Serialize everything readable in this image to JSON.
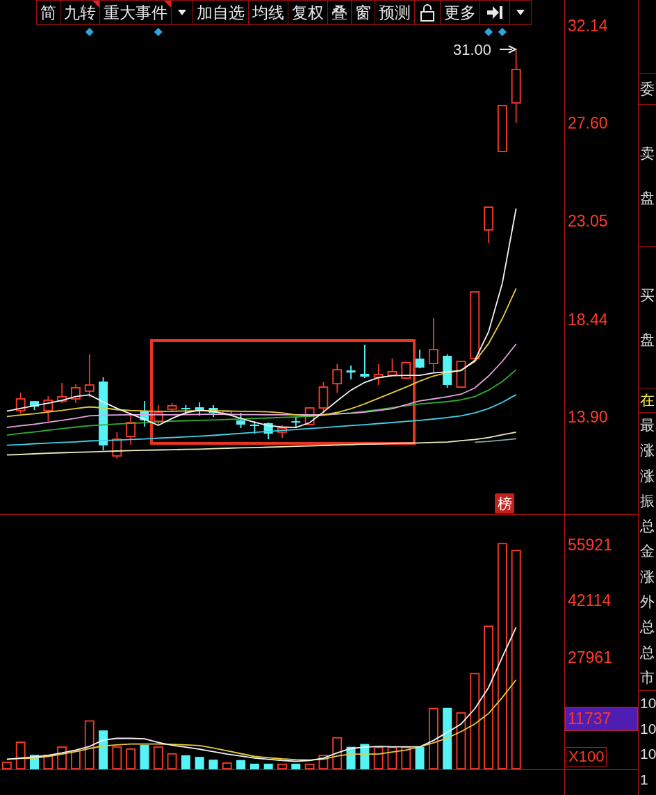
{
  "toolbar": [
    {
      "kind": "button",
      "label": "简",
      "flag": false
    },
    {
      "kind": "button",
      "label": "九转",
      "flag": true
    },
    {
      "kind": "button",
      "label": "重大事件",
      "flag": true
    },
    {
      "kind": "dropdown",
      "flag": false
    },
    {
      "kind": "button",
      "label": "加自选",
      "flag": false
    },
    {
      "kind": "button",
      "label": "均线",
      "flag": false
    },
    {
      "kind": "button",
      "label": "复权",
      "flag": false
    },
    {
      "kind": "button",
      "label": "叠",
      "flag": false
    },
    {
      "kind": "button",
      "label": "窗",
      "flag": false
    },
    {
      "kind": "button",
      "label": "预测",
      "flag": false
    },
    {
      "kind": "lock",
      "flag": false
    },
    {
      "kind": "button",
      "label": "更多",
      "flag": false
    },
    {
      "kind": "arrow_to_bar",
      "flag": false
    },
    {
      "kind": "dropdown",
      "flag": false
    }
  ],
  "price_chart": {
    "high_label": "31.00",
    "badge": "榜",
    "chart_data": {
      "type": "candlestick",
      "ylim": [
        9.33,
        33.34
      ],
      "yticks": [
        {
          "value": 32.14,
          "label": "32.14"
        },
        {
          "value": 27.6,
          "label": "27.60"
        },
        {
          "value": 23.05,
          "label": "23.05"
        },
        {
          "value": 18.44,
          "label": "18.44"
        },
        {
          "value": 13.9,
          "label": "13.90"
        }
      ],
      "ohlc": [
        null,
        [
          14.19,
          15.03,
          14.06,
          14.74
        ],
        [
          14.64,
          14.64,
          14.22,
          14.38
        ],
        [
          14.19,
          14.87,
          13.7,
          14.68
        ],
        [
          14.64,
          15.49,
          14.55,
          14.84
        ],
        [
          14.74,
          15.42,
          14.55,
          15.26
        ],
        [
          15.1,
          16.82,
          14.81,
          15.39
        ],
        [
          15.55,
          15.75,
          12.34,
          12.57
        ],
        [
          12.08,
          13.19,
          11.95,
          12.86
        ],
        [
          12.99,
          13.96,
          12.6,
          13.64
        ],
        [
          14.16,
          14.64,
          13.45,
          13.74
        ],
        [
          13.7,
          14.45,
          13.51,
          14.09
        ],
        [
          14.26,
          14.55,
          14.16,
          14.42
        ],
        [
          14.32,
          14.45,
          14.02,
          14.26
        ],
        [
          14.35,
          14.58,
          13.96,
          14.22
        ],
        [
          14.32,
          14.45,
          13.9,
          14.09
        ],
        [
          14.03,
          14.22,
          13.96,
          14.16
        ],
        [
          13.74,
          14.09,
          13.38,
          13.54
        ],
        [
          13.54,
          13.7,
          13.12,
          13.48
        ],
        [
          13.61,
          13.64,
          12.86,
          13.12
        ],
        [
          13.19,
          13.51,
          12.93,
          13.38
        ],
        [
          13.7,
          13.87,
          13.38,
          13.64
        ],
        [
          13.54,
          14.35,
          13.51,
          14.32
        ],
        [
          14.32,
          15.52,
          14.06,
          15.29
        ],
        [
          15.45,
          16.36,
          15.03,
          16.1
        ],
        [
          16.07,
          16.3,
          15.65,
          15.97
        ],
        [
          15.91,
          17.27,
          15.71,
          15.78
        ],
        [
          15.75,
          16.36,
          15.39,
          15.88
        ],
        [
          15.84,
          16.62,
          15.84,
          16.01
        ],
        [
          15.71,
          16.49,
          15.65,
          16.43
        ],
        [
          16.62,
          17.04,
          16.17,
          16.2
        ],
        [
          16.39,
          18.5,
          15.97,
          17.04
        ],
        [
          16.75,
          16.82,
          15.26,
          15.39
        ],
        [
          15.29,
          16.49,
          15.29,
          16.49
        ],
        [
          16.62,
          19.73,
          16.62,
          19.73
        ],
        [
          22.62,
          23.68,
          22.0,
          23.68
        ],
        [
          26.28,
          28.42,
          26.28,
          28.42
        ],
        [
          28.54,
          31.0,
          27.6,
          30.1
        ],
        null,
        null,
        null
      ],
      "series": [
        {
          "type": "line",
          "color": "#f4f4f4",
          "values": [
            14.17,
            14.3,
            14.42,
            14.54,
            14.67,
            14.85,
            14.93,
            14.6,
            14.3,
            14.04,
            13.78,
            13.51,
            13.83,
            14.1,
            14.21,
            14.15,
            14.03,
            13.83,
            13.65,
            13.5,
            13.43,
            13.41,
            13.63,
            14.13,
            14.65,
            15.15,
            15.51,
            15.73,
            15.82,
            15.84,
            15.84,
            15.95,
            16.0,
            16.06,
            16.54,
            17.87,
            20.14,
            23.62,
            null,
            null,
            null
          ]
        },
        {
          "type": "line",
          "color": "#e6cc3c",
          "values": [
            13.92,
            13.99,
            14.05,
            14.13,
            14.2,
            14.29,
            14.37,
            14.32,
            14.24,
            14.2,
            14.18,
            14.16,
            14.16,
            14.18,
            14.19,
            14.19,
            14.18,
            14.16,
            14.15,
            14.14,
            14.09,
            13.99,
            13.95,
            13.99,
            14.11,
            14.28,
            14.51,
            14.77,
            15.03,
            15.29,
            15.57,
            15.81,
            15.96,
            16.08,
            16.48,
            17.32,
            18.49,
            19.89,
            null,
            null,
            null
          ]
        },
        {
          "type": "line",
          "color": "#e3a2dc",
          "values": [
            13.41,
            13.49,
            13.56,
            13.65,
            13.74,
            13.84,
            13.95,
            13.98,
            13.99,
            14.0,
            14.0,
            14.0,
            14.0,
            14.01,
            14.02,
            14.03,
            14.02,
            14.01,
            14.01,
            14.0,
            14.0,
            14.0,
            14.0,
            14.01,
            14.04,
            14.07,
            14.12,
            14.2,
            14.28,
            14.47,
            14.65,
            14.74,
            14.84,
            14.96,
            15.25,
            15.81,
            16.49,
            17.3,
            null,
            null,
            null
          ]
        },
        {
          "type": "line",
          "color": "#2fae35",
          "values": [
            13.05,
            13.13,
            13.2,
            13.28,
            13.35,
            13.43,
            13.49,
            13.53,
            13.57,
            13.6,
            13.63,
            13.67,
            13.7,
            13.72,
            13.74,
            13.76,
            13.78,
            13.8,
            13.83,
            13.85,
            13.88,
            13.9,
            13.93,
            13.98,
            14.04,
            14.09,
            14.16,
            14.24,
            14.33,
            14.42,
            14.5,
            14.56,
            14.61,
            14.7,
            14.85,
            15.15,
            15.55,
            16.1,
            null,
            null,
            null
          ]
        },
        {
          "type": "line",
          "color": "#3fd3ea",
          "values": [
            12.58,
            12.61,
            12.65,
            12.68,
            12.71,
            12.74,
            12.78,
            12.8,
            12.82,
            12.85,
            12.87,
            12.91,
            12.94,
            12.97,
            13.0,
            13.04,
            13.09,
            13.13,
            13.18,
            13.22,
            13.27,
            13.31,
            13.36,
            13.4,
            13.45,
            13.5,
            13.54,
            13.59,
            13.64,
            13.69,
            13.74,
            13.8,
            13.87,
            13.95,
            14.09,
            14.29,
            14.58,
            14.94,
            null,
            null,
            null
          ]
        },
        {
          "type": "line",
          "color": "#ecebb8",
          "values": [
            12.13,
            12.15,
            12.18,
            12.21,
            12.23,
            12.25,
            12.27,
            12.29,
            12.31,
            12.33,
            12.35,
            12.36,
            12.37,
            12.39,
            12.4,
            12.42,
            12.44,
            12.46,
            12.47,
            12.49,
            12.51,
            12.53,
            12.55,
            12.57,
            12.59,
            12.61,
            12.63,
            12.64,
            12.66,
            12.68,
            12.69,
            12.71,
            12.73,
            12.79,
            12.85,
            12.94,
            13.07,
            13.19,
            null,
            null,
            null
          ]
        },
        {
          "type": "line",
          "color": "#7fa9a8",
          "values": [
            null,
            null,
            null,
            null,
            null,
            null,
            null,
            null,
            null,
            null,
            null,
            null,
            null,
            null,
            null,
            null,
            null,
            null,
            null,
            null,
            null,
            null,
            null,
            null,
            null,
            null,
            null,
            null,
            null,
            null,
            null,
            null,
            null,
            null,
            12.72,
            12.76,
            12.82,
            12.88,
            null,
            null,
            null
          ]
        }
      ]
    }
  },
  "volume_chart": {
    "current_value": "11737",
    "unit": "X100",
    "chart_data": {
      "type": "bar",
      "stacked": true,
      "ylim": [
        0,
        63390
      ],
      "yticks": [
        {
          "value": 55921,
          "label": "55921"
        },
        {
          "value": 42114,
          "label": "42114"
        },
        {
          "value": 27961,
          "label": "27961"
        }
      ],
      "series": [
        {
          "color": "#ff3c28",
          "values": [
            1900,
            6900,
            null,
            3600,
            5700,
            4700,
            12200,
            null,
            5700,
            5200,
            null,
            5700,
            4000,
            null,
            null,
            null,
            1700,
            null,
            null,
            null,
            1400,
            null,
            1400,
            3600,
            8000,
            null,
            null,
            5600,
            5600,
            5600,
            null,
            15300,
            null,
            14200,
            24000,
            35800,
            56400,
            54700,
            null,
            null,
            null
          ]
        },
        {
          "color": "#55f2f6",
          "values": [
            null,
            null,
            3600,
            null,
            null,
            null,
            null,
            9700,
            null,
            null,
            6100,
            null,
            null,
            3500,
            3100,
            2400,
            null,
            2300,
            1400,
            1400,
            null,
            1400,
            null,
            null,
            null,
            5600,
            6300,
            null,
            null,
            null,
            5600,
            null,
            15300,
            null,
            null,
            null,
            null,
            null,
            null,
            null,
            null
          ]
        },
        {
          "type": "line",
          "color": "#f4f4f4",
          "values": [
            2500,
            2800,
            3100,
            3500,
            4100,
            4800,
            5700,
            7300,
            7700,
            7700,
            7600,
            6700,
            6000,
            5500,
            5000,
            4400,
            3800,
            3300,
            2800,
            2500,
            2200,
            2000,
            2200,
            2800,
            4100,
            5200,
            5500,
            5700,
            5600,
            5600,
            5600,
            7200,
            9200,
            11300,
            15100,
            20400,
            28000,
            35400,
            null,
            null,
            null
          ]
        },
        {
          "type": "line",
          "color": "#e6cc3c",
          "values": [
            2500,
            2700,
            2800,
            3200,
            3800,
            4400,
            5200,
            5800,
            6100,
            6300,
            6300,
            6300,
            6200,
            6100,
            5900,
            5300,
            4600,
            3900,
            3200,
            2900,
            2600,
            2400,
            2300,
            2500,
            3300,
            3800,
            3800,
            3800,
            4300,
            4800,
            5600,
            6600,
            7800,
            9400,
            11300,
            13900,
            17900,
            22300,
            null,
            null,
            null
          ]
        }
      ]
    }
  },
  "side_panel": {
    "header": "委",
    "vertical_labels": [
      "卖盘",
      "买盘"
    ],
    "highlight": "在",
    "labels": [
      "最",
      "涨",
      "涨",
      "振",
      "总",
      "金",
      "涨",
      "外",
      "总",
      "总",
      "市"
    ],
    "values": [
      "10",
      "10",
      "10",
      "1"
    ]
  }
}
